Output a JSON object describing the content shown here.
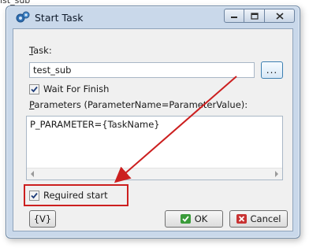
{
  "background": {
    "text": "ist_sub"
  },
  "window": {
    "title": "Start Task",
    "icons": {
      "app": "gear-task-icon",
      "minimize": "minimize-icon",
      "maximize": "maximize-icon",
      "close": "close-icon"
    }
  },
  "task": {
    "label_accel": "T",
    "label_rest": "ask:",
    "value": "test_sub",
    "browse_label": "..."
  },
  "wait_for_finish": {
    "label": "Wait For Finish",
    "checked": true
  },
  "parameters": {
    "label_accel": "P",
    "label_rest": "arameters (ParameterName=ParameterValue):",
    "value": "P_PARAMETER={TaskName}"
  },
  "required_start": {
    "label_pre": "Re",
    "label_accel": "q",
    "label_rest": "uired start",
    "checked": true
  },
  "buttons": {
    "variables_label": "{V}",
    "ok_label": "OK",
    "cancel_label": "Cancel"
  },
  "annotation": {
    "arrow_color": "#cc1f1f",
    "box_color": "#cc1f1f"
  }
}
